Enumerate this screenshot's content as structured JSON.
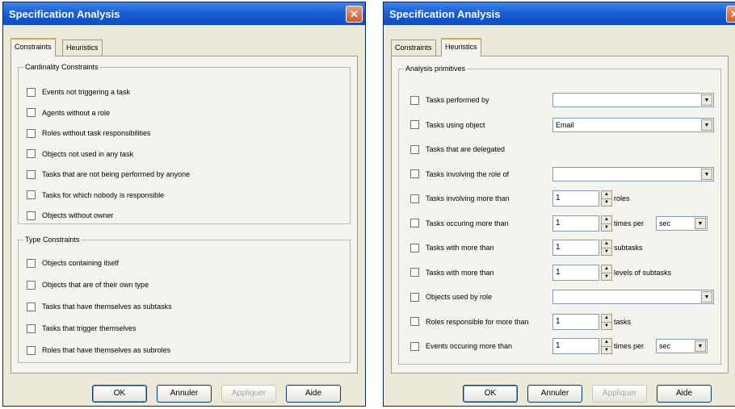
{
  "left_dialog": {
    "title": "Specification Analysis",
    "close_glyph": "✕",
    "tabs": [
      "Constraints",
      "Heuristics"
    ],
    "active_tab": "Constraints",
    "groups": [
      {
        "title": "Cardinality Constraints",
        "items": [
          "Events not triggering a task",
          "Agents without a role",
          "Roles without task responsibilities",
          "Objects not used in any task",
          "Tasks that are not being performed by anyone",
          "Tasks for which nobody is responsible",
          "Objects without owner"
        ]
      },
      {
        "title": "Type Constraints",
        "items": [
          "Objects containing itself",
          "Objects that are of their own type",
          "Tasks that have themselves as subtasks",
          "Tasks that trigger themselves",
          "Roles that have themselves as subroles"
        ]
      }
    ],
    "buttons": {
      "ok": "OK",
      "cancel": "Annuler",
      "apply": "Appliquer",
      "help": "Aide"
    }
  },
  "right_dialog": {
    "title": "Specification Analysis",
    "close_glyph": "✕",
    "tabs": [
      "Constraints",
      "Heuristics"
    ],
    "active_tab": "Heuristics",
    "group_title": "Analysis primitives",
    "rows": [
      {
        "label": "Tasks performed by",
        "control": "combo",
        "value": ""
      },
      {
        "label": "Tasks using object",
        "control": "combo",
        "value": "Email"
      },
      {
        "label": "Tasks that are delegated",
        "control": "none"
      },
      {
        "label": "Tasks involving the role of",
        "control": "combo",
        "value": ""
      },
      {
        "label": "Tasks involving more than",
        "control": "number",
        "value": "1",
        "unit": "roles"
      },
      {
        "label": "Tasks occuring more than",
        "control": "number",
        "value": "1",
        "unit": "times per",
        "select": "sec"
      },
      {
        "label": "Tasks with more than",
        "control": "number",
        "value": "1",
        "unit": "subtasks"
      },
      {
        "label": "Tasks with more than",
        "control": "number",
        "value": "1",
        "unit": "levels of subtasks"
      },
      {
        "label": "Objects used by role",
        "control": "combo",
        "value": ""
      },
      {
        "label": "Roles responsible for more than",
        "control": "number",
        "value": "1",
        "unit": "tasks"
      },
      {
        "label": "Events occuring more than",
        "control": "number",
        "value": "1",
        "unit": "times per",
        "select": "sec"
      }
    ],
    "buttons": {
      "ok": "OK",
      "cancel": "Annuler",
      "apply": "Appliquer",
      "help": "Aide"
    }
  },
  "colors": {
    "titlebar": "#1a5fd6",
    "dialog_bg": "#ece9d8",
    "close": "#d4572e",
    "tab_highlight": "#e8a33a"
  },
  "icons": {
    "close": "close-icon",
    "dropdown": "dropdown-arrow-icon",
    "spin_up": "spin-up-icon",
    "spin_down": "spin-down-icon"
  }
}
